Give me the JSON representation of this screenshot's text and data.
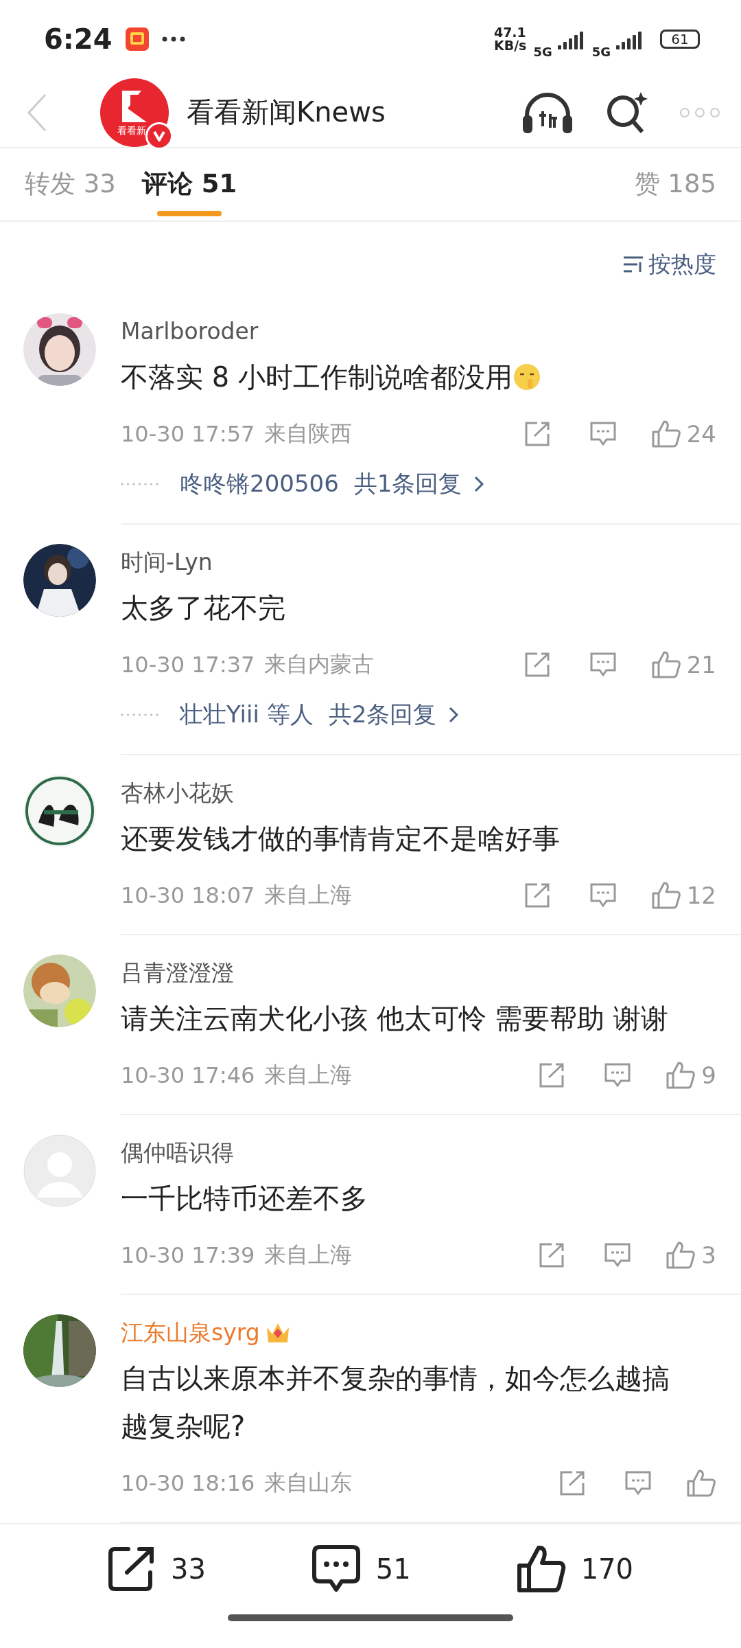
{
  "status_bar": {
    "time": "6:24",
    "network_speed": "47.1 KB/s",
    "sim_1": "5G",
    "sim_2": "5G",
    "battery": "61"
  },
  "header": {
    "title": "看看新闻Knews",
    "logo_text": "看看新",
    "verified": true
  },
  "tabs": [
    {
      "label": "转发 33",
      "selected": false
    },
    {
      "label": "评论 51",
      "selected": true
    },
    {
      "label": "赞 185",
      "selected": false
    }
  ],
  "sort": {
    "label": "按热度"
  },
  "comments": [
    {
      "name": "Marlboroder",
      "vip": false,
      "text": "不落实 8 小时工作制说啥都没用",
      "emoji": true,
      "time": "10-30 17:57",
      "location": "来自陕西",
      "likes": "24",
      "reply": {
        "names": "咚咚锵200506",
        "count": "共1条回复"
      }
    },
    {
      "name": "时间-Lyn",
      "vip": false,
      "text": "太多了花不完",
      "time": "10-30 17:37",
      "location": "来自内蒙古",
      "likes": "21",
      "reply": {
        "names": "壮壮Yiii 等人",
        "count": "共2条回复"
      }
    },
    {
      "name": "杏林小花妖",
      "vip": false,
      "text": "还要发钱才做的事情肯定不是啥好事",
      "time": "10-30 18:07",
      "location": "来自上海",
      "likes": "12"
    },
    {
      "name": "吕青澄澄澄",
      "vip": false,
      "text": "请关注云南犬化小孩 他太可怜 需要帮助 谢谢",
      "time": "10-30 17:46",
      "location": "来自上海",
      "likes": "9"
    },
    {
      "avatar": {
        "kind": "default"
      },
      "name": "偶仲唔识得",
      "vip": false,
      "text": "一千比特币还差不多",
      "time": "10-30 17:39",
      "location": "来自上海",
      "likes": "3"
    },
    {
      "name": "江东山泉syrg",
      "vip": true,
      "text": "自古以来原本并不复杂的事情，如今怎么越搞越复杂呢?",
      "time": "10-30 18:16",
      "location": "来自山东"
    }
  ],
  "bottom_bar": {
    "reposts": "33",
    "comments": "51",
    "likes": "170"
  }
}
